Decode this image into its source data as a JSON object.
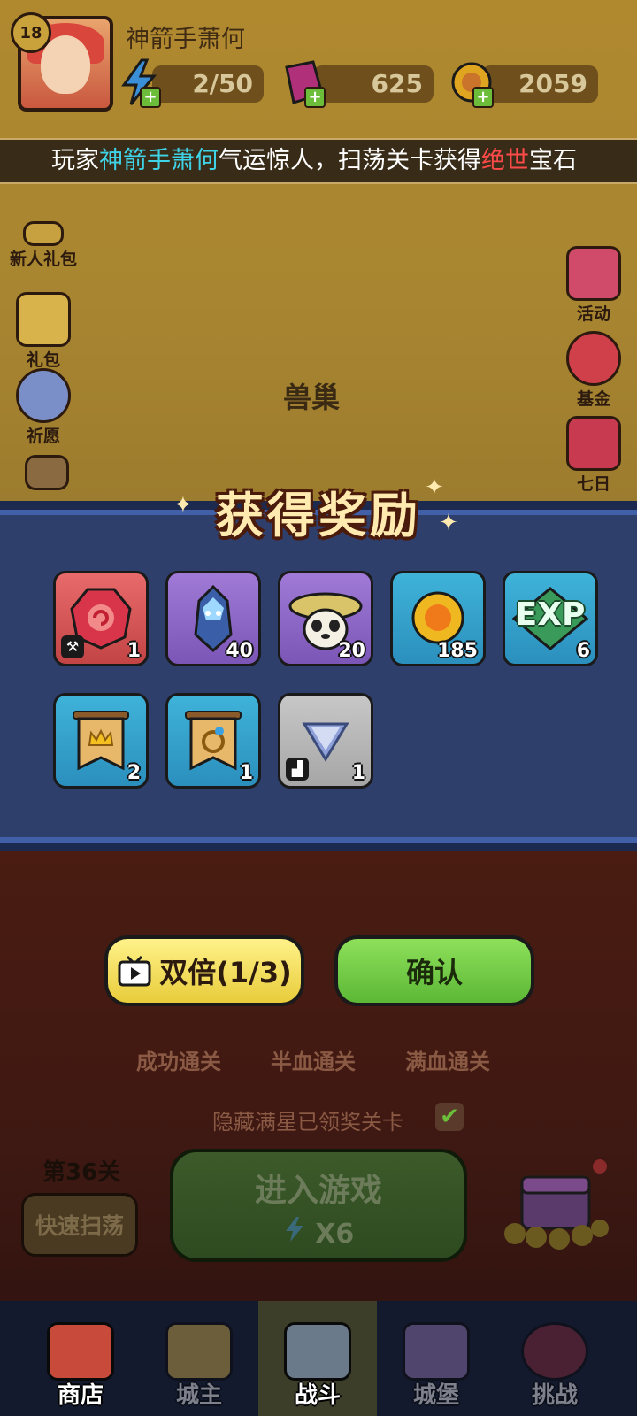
{
  "header": {
    "level": "18",
    "player_name": "神箭手萧何",
    "stamina": "2/50",
    "gems": "625",
    "coins": "2059"
  },
  "marquee": {
    "prefix": "玩家",
    "name": "神箭手萧何",
    "middle": "气运惊人，扫荡关卡获得",
    "rare": "绝世",
    "suffix": "宝石"
  },
  "side_left": [
    "新人礼包",
    "礼包",
    "祈愿"
  ],
  "side_right": [
    "活动",
    "基金",
    "七日"
  ],
  "stage_name": "兽巢",
  "reward_modal": {
    "title": "获得奖励",
    "items": [
      {
        "icon": "ruby-gem-icon",
        "count": "1",
        "rarity": "red"
      },
      {
        "icon": "dark-knight-card-icon",
        "count": "40",
        "rarity": "purple"
      },
      {
        "icon": "panda-hero-card-icon",
        "count": "20",
        "rarity": "purple"
      },
      {
        "icon": "gold-coin-icon",
        "count": "185",
        "rarity": "blue"
      },
      {
        "icon": "exp-icon",
        "count": "6",
        "rarity": "blue",
        "label": "EXP"
      },
      {
        "icon": "crown-banner-icon",
        "count": "2",
        "rarity": "blue"
      },
      {
        "icon": "ring-banner-icon",
        "count": "1",
        "rarity": "blue"
      },
      {
        "icon": "gray-triangle-gem-icon",
        "count": "1",
        "rarity": "gray"
      }
    ]
  },
  "buttons": {
    "double": "双倍(1/3)",
    "confirm": "确认"
  },
  "chests": [
    "成功通关",
    "半血通关",
    "满血通关"
  ],
  "hide_toggle": "隐藏满星已领奖关卡",
  "level_label": "第36关",
  "sweep_button": "快速扫荡",
  "enter_button": {
    "label": "进入游戏",
    "cost": "X6"
  },
  "nav": [
    "商店",
    "城主",
    "战斗",
    "城堡",
    "挑战"
  ],
  "colors": {
    "highlight_name": "#3fd3e8",
    "highlight_rare": "#ff4a4a",
    "modal_bg": "#2f3f6b",
    "confirm_green": "#6bc83d",
    "double_yellow": "#f0dc55"
  }
}
